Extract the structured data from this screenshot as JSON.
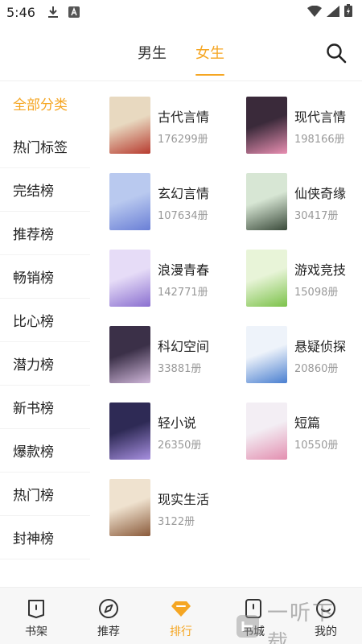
{
  "status_bar": {
    "time": "5:46"
  },
  "top_tabs": [
    {
      "label": "男生",
      "active": false
    },
    {
      "label": "女生",
      "active": true
    }
  ],
  "sidebar": {
    "items": [
      {
        "label": "全部分类",
        "active": true
      },
      {
        "label": "热门标签"
      },
      {
        "label": "完结榜"
      },
      {
        "label": "推荐榜"
      },
      {
        "label": "畅销榜"
      },
      {
        "label": "比心榜"
      },
      {
        "label": "潜力榜"
      },
      {
        "label": "新书榜"
      },
      {
        "label": "爆款榜"
      },
      {
        "label": "热门榜"
      },
      {
        "label": "封神榜"
      }
    ]
  },
  "categories": [
    {
      "name": "古代言情",
      "count": "176299册",
      "cover_colors": [
        "#e8d9c0",
        "#b73b2f"
      ]
    },
    {
      "name": "现代言情",
      "count": "198166册",
      "cover_colors": [
        "#3a2a3a",
        "#e98fb2"
      ]
    },
    {
      "name": "玄幻言情",
      "count": "107634册",
      "cover_colors": [
        "#b9c9ef",
        "#6a7fd6"
      ]
    },
    {
      "name": "仙侠奇缘",
      "count": "30417册",
      "cover_colors": [
        "#d7e6d4",
        "#3a4a3a"
      ]
    },
    {
      "name": "浪漫青春",
      "count": "142771册",
      "cover_colors": [
        "#e6dcf7",
        "#8a6fd0"
      ]
    },
    {
      "name": "游戏竞技",
      "count": "15098册",
      "cover_colors": [
        "#e8f4d8",
        "#7cc24a"
      ]
    },
    {
      "name": "科幻空间",
      "count": "33881册",
      "cover_colors": [
        "#3b3048",
        "#cfb6d9"
      ]
    },
    {
      "name": "悬疑侦探",
      "count": "20860册",
      "cover_colors": [
        "#eef3fa",
        "#4a7fd0"
      ]
    },
    {
      "name": "轻小说",
      "count": "26350册",
      "cover_colors": [
        "#2e2a55",
        "#a78fe0"
      ]
    },
    {
      "name": "短篇",
      "count": "10550册",
      "cover_colors": [
        "#f3eef4",
        "#e38fb0"
      ]
    },
    {
      "name": "现实生活",
      "count": "3122册",
      "cover_colors": [
        "#efe2cf",
        "#8a5a3a"
      ]
    }
  ],
  "bottom_nav": [
    {
      "label": "书架",
      "icon": "bookshelf-icon"
    },
    {
      "label": "推荐",
      "icon": "compass-icon"
    },
    {
      "label": "排行",
      "icon": "diamond-icon",
      "active": true
    },
    {
      "label": "书城",
      "icon": "book-icon"
    },
    {
      "label": "我的",
      "icon": "smile-icon"
    }
  ],
  "watermark": "一听下载",
  "colors": {
    "accent": "#f5a623",
    "text": "#222222",
    "muted": "#999999"
  }
}
